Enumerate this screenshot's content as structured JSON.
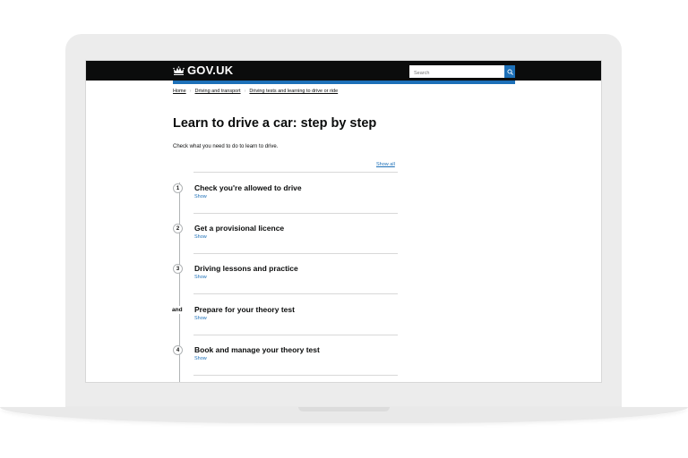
{
  "header": {
    "logo_text": "GOV.UK",
    "search_placeholder": "Search",
    "search_icon": "magnifier-icon",
    "logo_icon": "crown-icon"
  },
  "breadcrumb": {
    "items": [
      "Home",
      "Driving and transport",
      "Driving tests and learning to drive or ride"
    ]
  },
  "main": {
    "title": "Learn to drive a car: step by step",
    "lede": "Check what you need to do to learn to drive.",
    "show_all": "Show all",
    "steps": [
      {
        "marker": "1",
        "title": "Check you're allowed to drive",
        "toggle": "Show"
      },
      {
        "marker": "2",
        "title": "Get a provisional licence",
        "toggle": "Show"
      },
      {
        "marker": "3",
        "title": "Driving lessons and practice",
        "toggle": "Show"
      },
      {
        "marker": "and",
        "title": "Prepare for your theory test",
        "toggle": "Show"
      },
      {
        "marker": "4",
        "title": "Book and manage your theory test",
        "toggle": "Show"
      }
    ]
  },
  "colors": {
    "header_bg": "#0b0c0c",
    "accent_blue": "#1d70b8",
    "text": "#0b0c0c",
    "rule": "#d8d8d8"
  }
}
